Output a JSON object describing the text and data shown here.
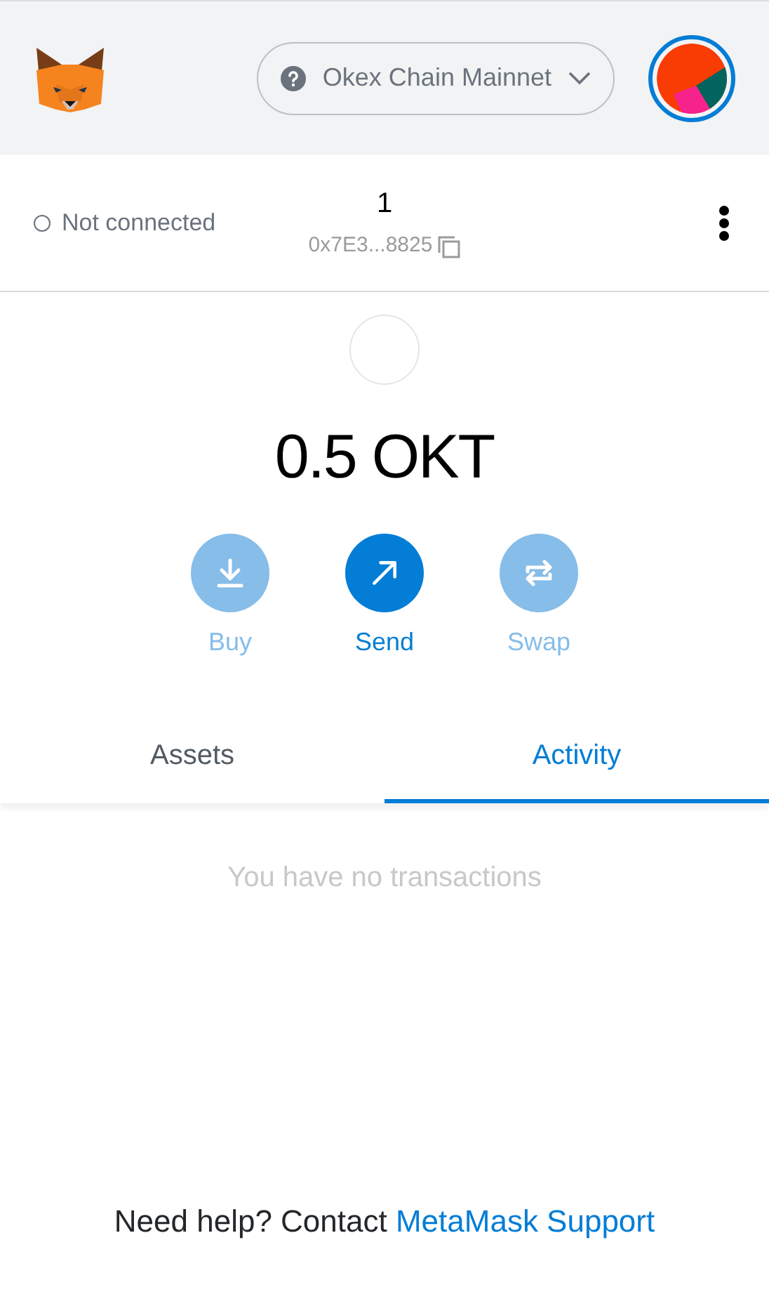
{
  "header": {
    "network": "Okex Chain Mainnet"
  },
  "account": {
    "connection": "Not connected",
    "name": "1",
    "address": "0x7E3...8825"
  },
  "balance": "0.5 OKT",
  "actions": [
    {
      "label": "Buy",
      "kind": "buy",
      "disabled": true
    },
    {
      "label": "Send",
      "kind": "send",
      "disabled": false
    },
    {
      "label": "Swap",
      "kind": "swap",
      "disabled": true
    }
  ],
  "tabs": [
    {
      "label": "Assets",
      "selected": false
    },
    {
      "label": "Activity",
      "selected": true
    }
  ],
  "empty_message": "You have no transactions",
  "footer": {
    "text": "Need help? Contact ",
    "link": "MetaMask Support"
  }
}
